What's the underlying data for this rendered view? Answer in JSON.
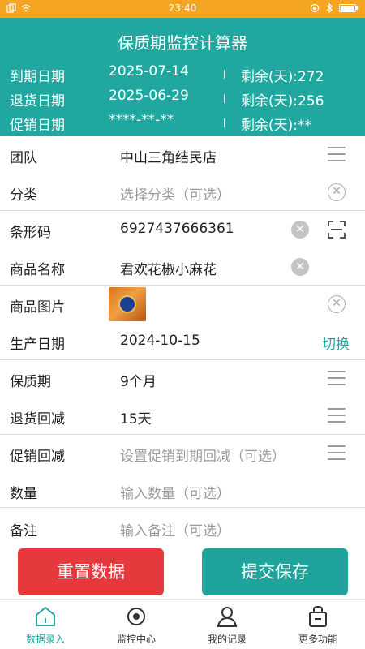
{
  "status_bar": {
    "time": "23:40"
  },
  "header": {
    "title": "保质期监控计算器",
    "rows": [
      {
        "label": "到期日期",
        "value": "2025-07-14",
        "remaining": "剩余(天):272"
      },
      {
        "label": "退货日期",
        "value": "2025-06-29",
        "remaining": "剩余(天):256"
      },
      {
        "label": "促销日期",
        "value": "****-**-**",
        "remaining": "剩余(天):**"
      }
    ]
  },
  "form": {
    "team": {
      "label": "团队",
      "value": "中山三角结民店"
    },
    "category": {
      "label": "分类",
      "placeholder": "选择分类（可选）"
    },
    "barcode": {
      "label": "条形码",
      "value": "6927437666361"
    },
    "product_name": {
      "label": "商品名称",
      "value": "君欢花椒小麻花"
    },
    "product_image": {
      "label": "商品图片"
    },
    "production_date": {
      "label": "生产日期",
      "value": "2024-10-15",
      "switch_label": "切换"
    },
    "shelf_life": {
      "label": "保质期",
      "value": "9个月"
    },
    "return_reduce": {
      "label": "退货回减",
      "value": "15天"
    },
    "promo_reduce": {
      "label": "促销回减",
      "placeholder": "设置促销到期回减（可选）"
    },
    "quantity": {
      "label": "数量",
      "placeholder": "输入数量（可选）"
    },
    "remark": {
      "label": "备注",
      "placeholder": "输入备注（可选）"
    }
  },
  "actions": {
    "reset_label": "重置数据",
    "save_label": "提交保存"
  },
  "tabs": [
    {
      "label": "数据录入",
      "icon": "home-icon",
      "active": true
    },
    {
      "label": "监控中心",
      "icon": "target-icon",
      "active": false
    },
    {
      "label": "我的记录",
      "icon": "user-icon",
      "active": false
    },
    {
      "label": "更多功能",
      "icon": "bag-icon",
      "active": false
    }
  ],
  "colors": {
    "primary": "#20a8a0",
    "danger": "#e6393e",
    "status_bar": "#f5a524"
  }
}
